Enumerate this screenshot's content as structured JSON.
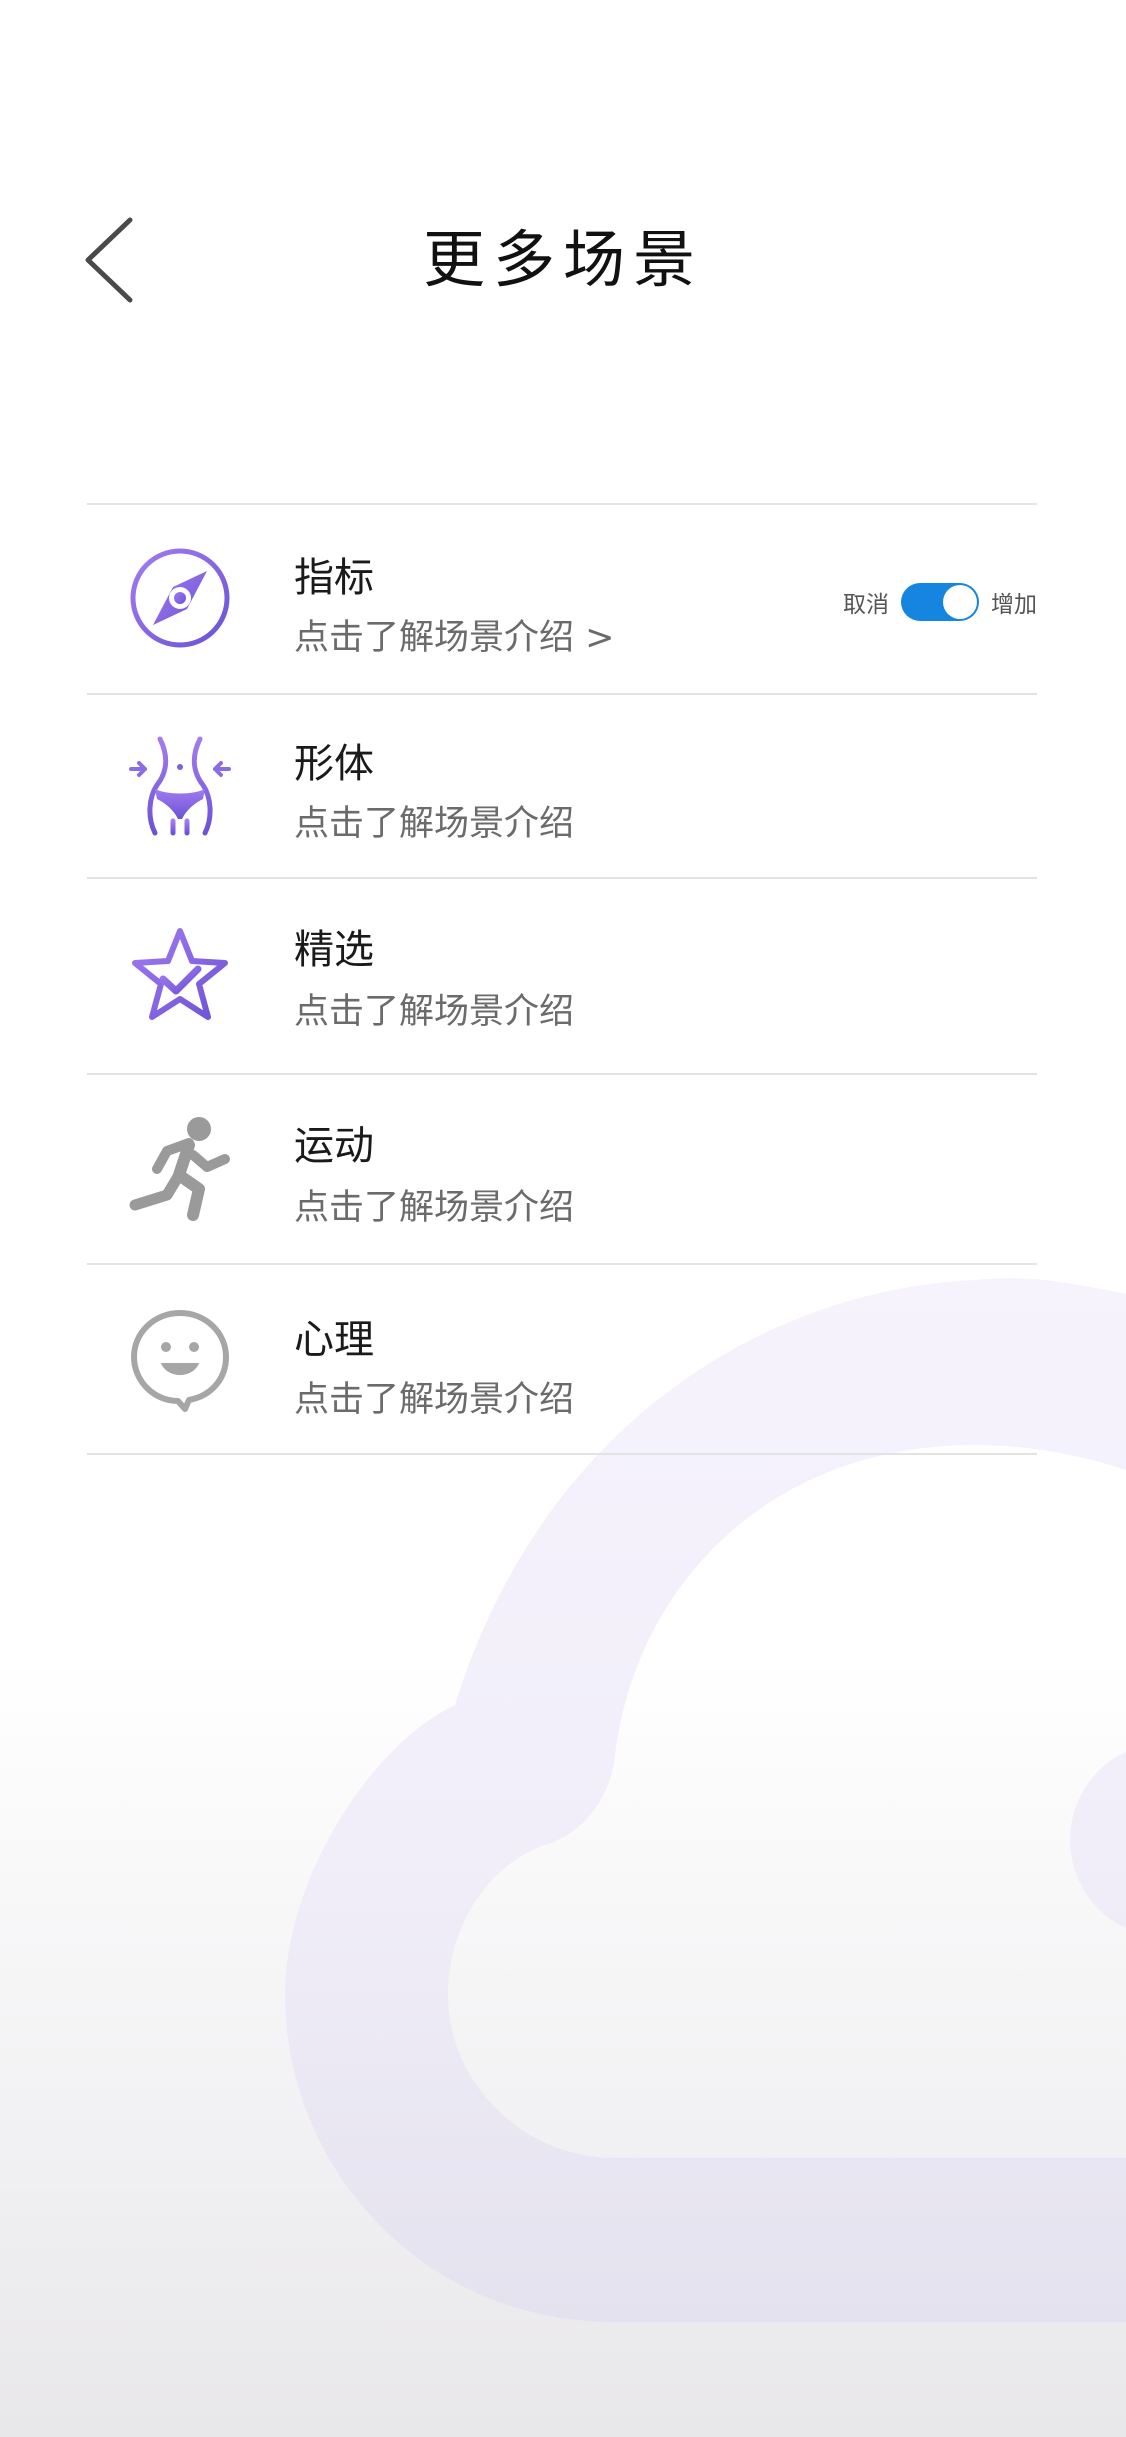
{
  "header": {
    "title": "更多场景",
    "back_icon": "chevron-left-icon"
  },
  "scenes": [
    {
      "title": "指标",
      "subtitle": "点击了解场景介绍 >",
      "icon": "compass-icon",
      "color": "#7b61e0"
    },
    {
      "title": "形体",
      "subtitle": "点击了解场景介绍",
      "icon": "waist-body-icon",
      "color": "#7b61e0"
    },
    {
      "title": "精选",
      "subtitle": "点击了解场景介绍",
      "icon": "star-check-icon",
      "color": "#7b61e0"
    },
    {
      "title": "运动",
      "subtitle": "点击了解场景介绍",
      "icon": "running-person-icon",
      "color": "#9a9a9a"
    },
    {
      "title": "心理",
      "subtitle": "点击了解场景介绍",
      "icon": "smiley-chat-icon",
      "color": "#a0a0a0"
    }
  ],
  "toggle": {
    "off_label": "取消",
    "on_label": "增加",
    "state": "on",
    "color": "#1585e0"
  },
  "colors": {
    "accent_purple": "#7b61e0",
    "cloud": "#f3f0fb"
  }
}
